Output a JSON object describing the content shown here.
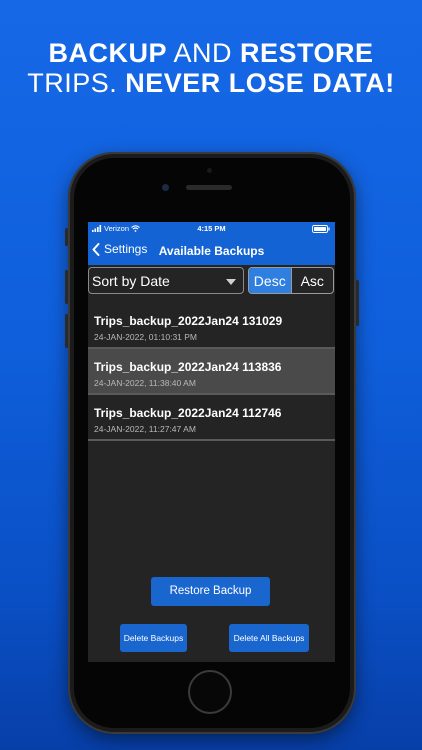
{
  "headline": {
    "line1_bold_a": "BACKUP",
    "line1_light": " AND ",
    "line1_bold_b": "RESTORE",
    "line2_light": "TRIPS. ",
    "line2_bold": "NEVER LOSE DATA!"
  },
  "status_bar": {
    "carrier": "Verizon",
    "time": "4:15 PM"
  },
  "nav": {
    "back_label": "Settings",
    "title": "Available Backups"
  },
  "controls": {
    "sort_value": "Sort by Date",
    "order_options": [
      "Desc",
      "Asc"
    ],
    "order_selected": "Desc"
  },
  "backups": [
    {
      "name": "Trips_backup_2022Jan24 131029",
      "date": "24-JAN-2022, 01:10:31 PM",
      "selected": false
    },
    {
      "name": "Trips_backup_2022Jan24 113836",
      "date": "24-JAN-2022, 11:38:40 AM",
      "selected": true
    },
    {
      "name": "Trips_backup_2022Jan24 112746",
      "date": "24-JAN-2022, 11:27:47 AM",
      "selected": false
    }
  ],
  "actions": {
    "restore_label": "Restore Backup",
    "delete_label": "Delete Backups",
    "delete_all_label": "Delete All Backups"
  },
  "colors": {
    "background_top": "#1668e6",
    "nav_blue": "#1363d4",
    "button_blue": "#1a66cf",
    "segment_active": "#2f7fe0"
  }
}
